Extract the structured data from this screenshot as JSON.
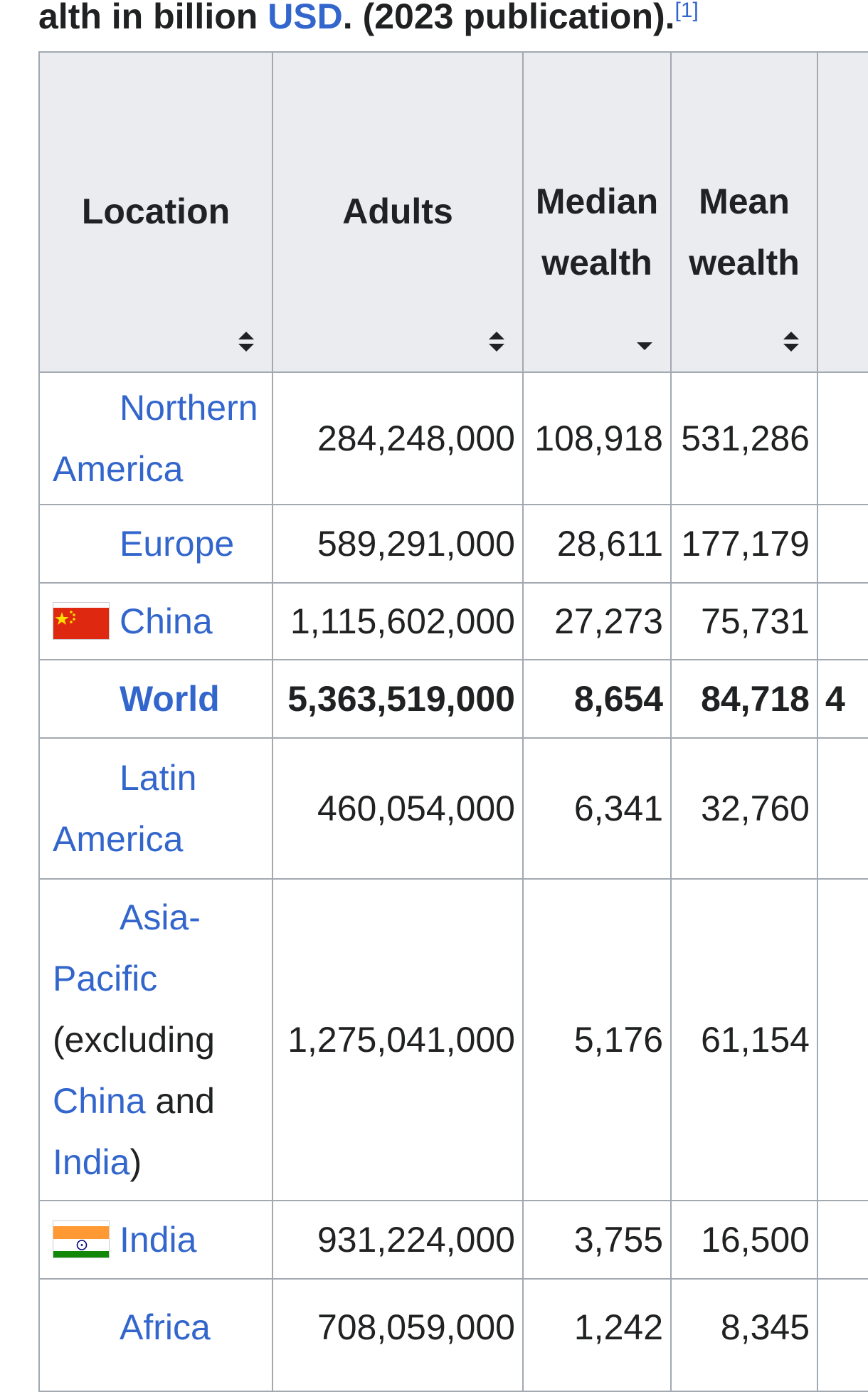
{
  "caption": {
    "prefix": "alth in billion ",
    "usd_link": "USD",
    "suffix": ". (2023 publication).",
    "ref": "[1]"
  },
  "headers": {
    "location": "Location",
    "adults": "Adults",
    "median_line1": "Median",
    "median_line2": "wealth",
    "mean_line1": "Mean",
    "mean_line2": "wealth"
  },
  "sort_icons": {
    "location": "sort-both-icon",
    "adults": "sort-both-icon",
    "median": "sort-descending-icon",
    "mean": "sort-both-icon"
  },
  "rows": [
    {
      "loc_line1": "Northern",
      "loc_line2": "America",
      "adults": "284,248,000",
      "median": "108,918",
      "mean": "531,286"
    },
    {
      "loc": "Europe",
      "adults": "589,291,000",
      "median": "28,611",
      "mean": "177,179"
    },
    {
      "loc": "China",
      "flag": "china-flag-icon",
      "adults": "1,115,602,000",
      "median": "27,273",
      "mean": "75,731"
    },
    {
      "loc": "World",
      "adults": "5,363,519,000",
      "median": "8,654",
      "mean": "84,718",
      "next_col_fragment": "4"
    },
    {
      "loc_line1": "Latin",
      "loc_line2": "America",
      "adults": "460,054,000",
      "median": "6,341",
      "mean": "32,760"
    },
    {
      "loc_line1": "Asia-",
      "loc_line2": "Pacific",
      "loc_line3": "(excluding",
      "loc_line4_link": "China",
      "loc_line4_text": " and",
      "loc_line5_link": "India",
      "loc_line5_text": ")",
      "adults": "1,275,041,000",
      "median": "5,176",
      "mean": "61,154"
    },
    {
      "loc": "India",
      "flag": "india-flag-icon",
      "adults": "931,224,000",
      "median": "3,755",
      "mean": "16,500"
    },
    {
      "loc": "Africa",
      "adults": "708,059,000",
      "median": "1,242",
      "mean": "8,345"
    }
  ],
  "colors": {
    "link": "#3366cc",
    "header_bg": "#eaecf0",
    "border": "#a2a9b1",
    "text": "#202122"
  }
}
